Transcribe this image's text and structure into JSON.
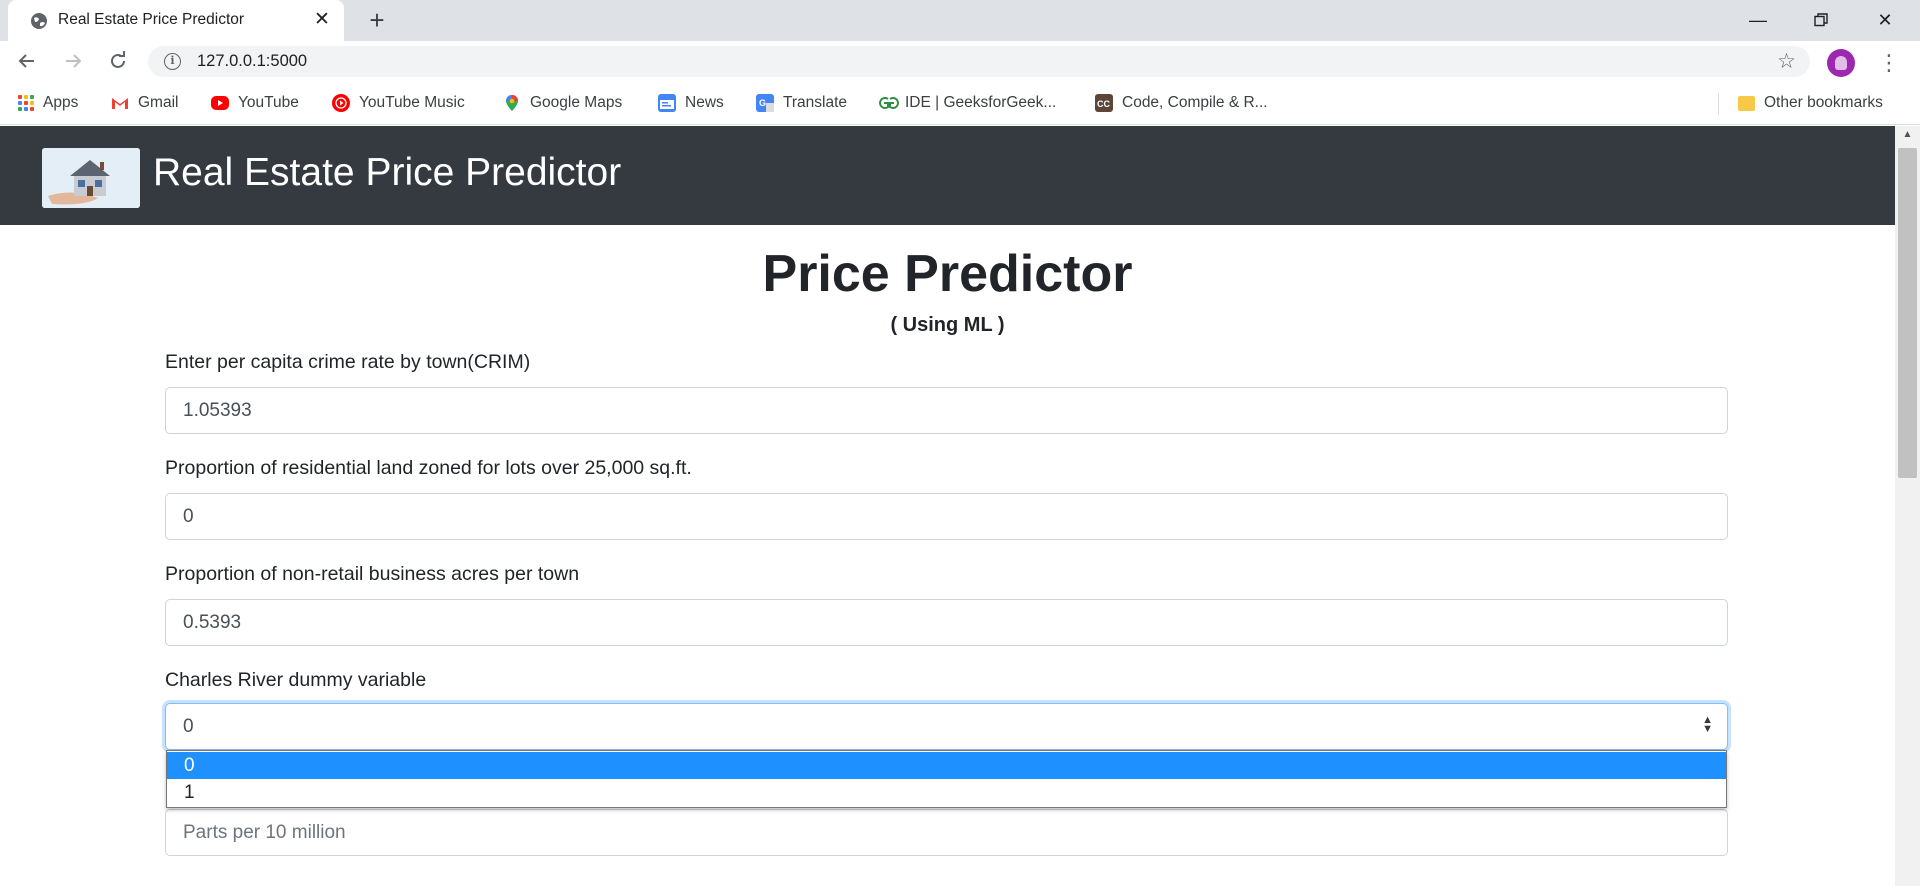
{
  "browser": {
    "tab_title": "Real Estate Price Predictor",
    "url": "127.0.0.1:5000",
    "bookmarks": [
      {
        "label": "Apps",
        "icon": "apps-grid-icon"
      },
      {
        "label": "Gmail",
        "icon": "gmail-icon"
      },
      {
        "label": "YouTube",
        "icon": "youtube-icon"
      },
      {
        "label": "YouTube Music",
        "icon": "youtube-music-icon"
      },
      {
        "label": "Google Maps",
        "icon": "google-maps-icon"
      },
      {
        "label": "News",
        "icon": "google-news-icon"
      },
      {
        "label": "Translate",
        "icon": "google-translate-icon"
      },
      {
        "label": "IDE | GeeksforGeek...",
        "icon": "geeksforgeeks-icon"
      },
      {
        "label": "Code, Compile & R...",
        "icon": "codechef-icon"
      }
    ],
    "other_bookmarks": "Other bookmarks"
  },
  "navbar": {
    "brand": "Real Estate Price Predictor"
  },
  "page": {
    "heading": "Price Predictor",
    "subheading": "( Using ML )"
  },
  "form": {
    "crim_label": "Enter per capita crime rate by town(CRIM)",
    "crim_value": "1.05393",
    "zn_label": "Proportion of residential land zoned for lots over 25,000 sq.ft.",
    "zn_value": "0",
    "indus_label": "Proportion of non-retail business acres per town",
    "indus_value": "0.5393",
    "chas_label": "Charles River dummy variable",
    "chas_value": "0",
    "chas_options": [
      "0",
      "1"
    ],
    "nox_placeholder": "Parts per 10 million"
  },
  "colors": {
    "navbar_bg": "#343a40",
    "selected_option": "#1e90ff",
    "focus_border": "#80bdff"
  }
}
